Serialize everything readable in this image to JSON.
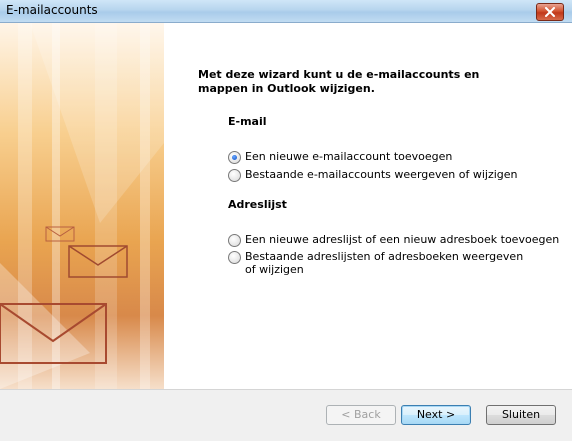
{
  "window": {
    "title": "E-mailaccounts"
  },
  "intro": "Met deze wizard kunt u de e-mailaccounts en mappen in Outlook wijzigen.",
  "email_section": {
    "heading": "E-mail",
    "options": [
      {
        "label": "Een nieuwe e-mailaccount toevoegen",
        "checked": true
      },
      {
        "label": "Bestaande e-mailaccounts weergeven of wijzigen",
        "checked": false
      }
    ]
  },
  "address_section": {
    "heading": "Adreslijst",
    "options": [
      {
        "label": "Een nieuwe adreslijst of een nieuw adresboek toevoegen",
        "checked": false
      },
      {
        "label": "Bestaande adreslijsten of adresboeken weergeven of wijzigen",
        "checked": false
      }
    ]
  },
  "buttons": {
    "back": "< Back",
    "next": "Next >",
    "close": "Sluiten"
  },
  "icons": {
    "close": "close-icon"
  }
}
